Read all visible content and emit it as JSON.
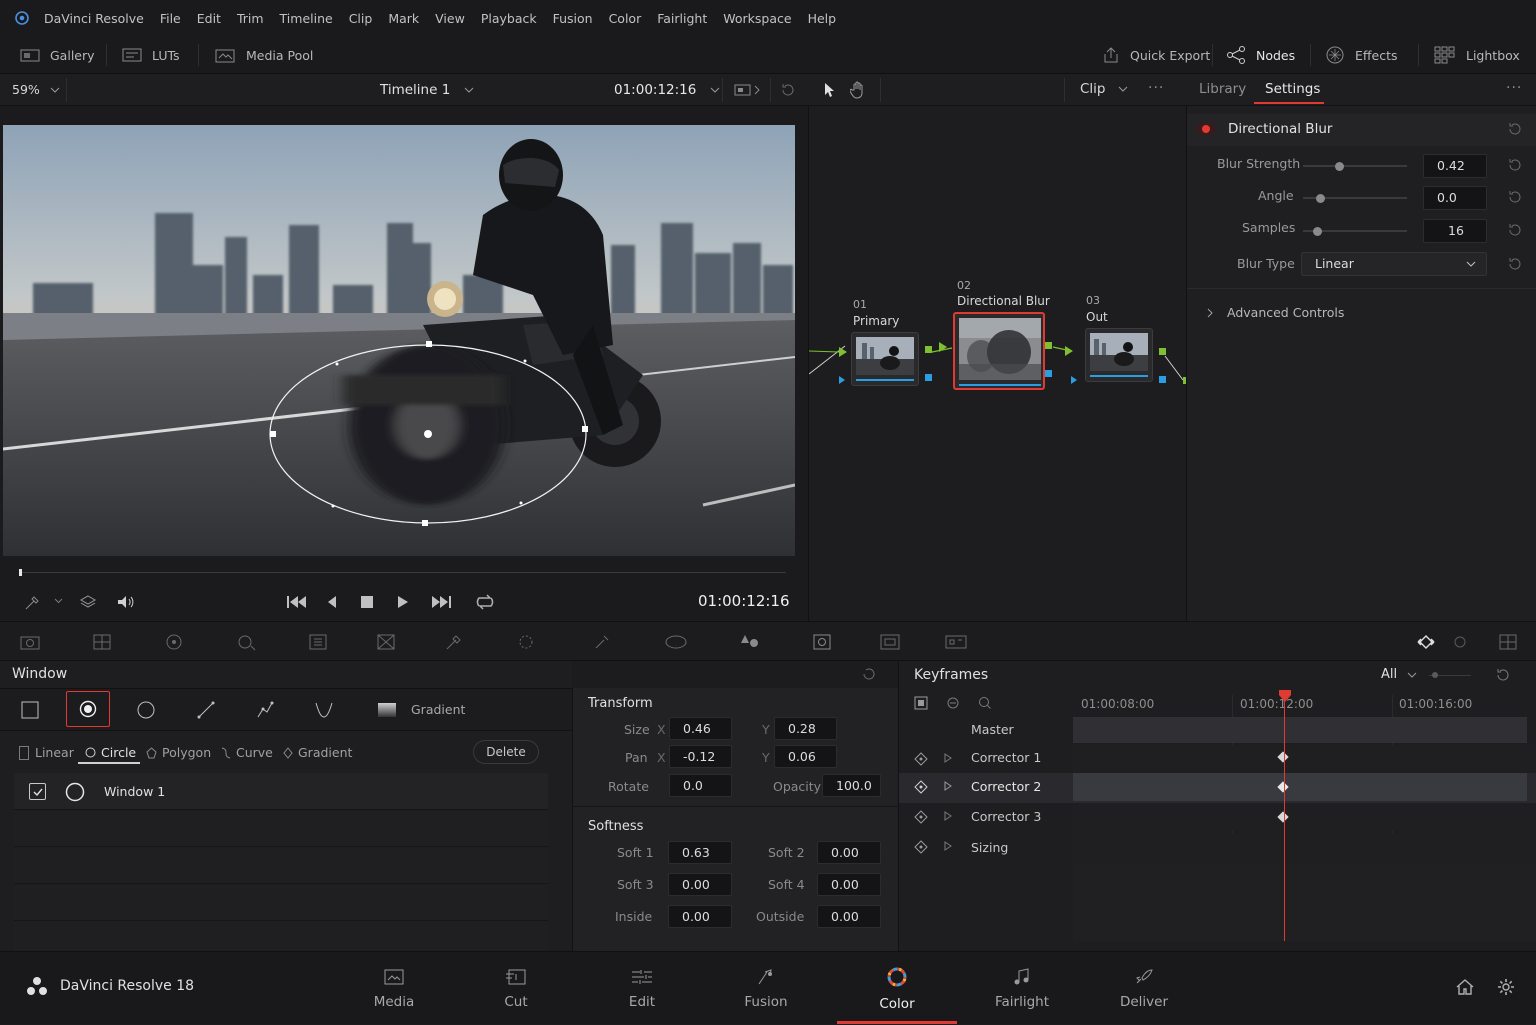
{
  "app": {
    "name": "DaVinci Resolve",
    "footer_name": "DaVinci Resolve 18"
  },
  "menu": [
    "File",
    "Edit",
    "Trim",
    "Timeline",
    "Clip",
    "Mark",
    "View",
    "Playback",
    "Fusion",
    "Color",
    "Fairlight",
    "Workspace",
    "Help"
  ],
  "toolbar": {
    "gallery": "Gallery",
    "luts": "LUTs",
    "media_pool": "Media Pool",
    "quick_export": "Quick Export",
    "nodes": "Nodes",
    "effects": "Effects",
    "lightbox": "Lightbox"
  },
  "viewer": {
    "zoom": "59%",
    "timeline": "Timeline 1",
    "timecode": "01:00:12:16",
    "playback_timecode": "01:00:12:16"
  },
  "node_editor": {
    "mode": "Clip",
    "nodes": [
      {
        "num": "01",
        "label": "Primary"
      },
      {
        "num": "02",
        "label": "Directional Blur"
      },
      {
        "num": "03",
        "label": "Out"
      }
    ]
  },
  "settings": {
    "tabs": [
      "Library",
      "Settings"
    ],
    "active_tab": "Settings",
    "effect_name": "Directional Blur",
    "params": [
      {
        "label": "Blur Strength",
        "value": "0.42"
      },
      {
        "label": "Angle",
        "value": "0.0"
      },
      {
        "label": "Samples",
        "value": "16"
      }
    ],
    "blur_type_label": "Blur Type",
    "blur_type_value": "Linear",
    "advanced": "Advanced Controls"
  },
  "window_panel": {
    "title": "Window",
    "gradient": "Gradient",
    "shape_tabs": [
      "Linear",
      "Circle",
      "Polygon",
      "Curve",
      "Gradient"
    ],
    "active_shape": "Circle",
    "delete": "Delete",
    "windows": [
      {
        "name": "Window 1",
        "enabled": true
      }
    ]
  },
  "transform": {
    "title": "Transform",
    "size_label": "Size",
    "size_x": "0.46",
    "size_y": "0.28",
    "pan_label": "Pan",
    "pan_x": "-0.12",
    "pan_y": "0.06",
    "rotate_label": "Rotate",
    "rotate": "0.0",
    "opacity_label": "Opacity",
    "opacity": "100.0",
    "x": "X",
    "y": "Y"
  },
  "softness": {
    "title": "Softness",
    "soft1_label": "Soft 1",
    "soft1": "0.63",
    "soft2_label": "Soft 2",
    "soft2": "0.00",
    "soft3_label": "Soft 3",
    "soft3": "0.00",
    "soft4_label": "Soft 4",
    "soft4": "0.00",
    "inside_label": "Inside",
    "inside": "0.00",
    "outside_label": "Outside",
    "outside": "0.00"
  },
  "keyframes": {
    "title": "Keyframes",
    "filter": "All",
    "ruler": [
      "01:00:08:00",
      "01:00:12:00",
      "01:00:16:00"
    ],
    "tracks": [
      "Master",
      "Corrector 1",
      "Corrector 2",
      "Corrector 3",
      "Sizing"
    ]
  },
  "pages": [
    "Media",
    "Cut",
    "Edit",
    "Fusion",
    "Color",
    "Fairlight",
    "Deliver"
  ],
  "active_page": "Color",
  "colors": {
    "accent_red": "#e03a32",
    "node_green": "#7ec02f",
    "node_blue": "#2a9ee0"
  }
}
